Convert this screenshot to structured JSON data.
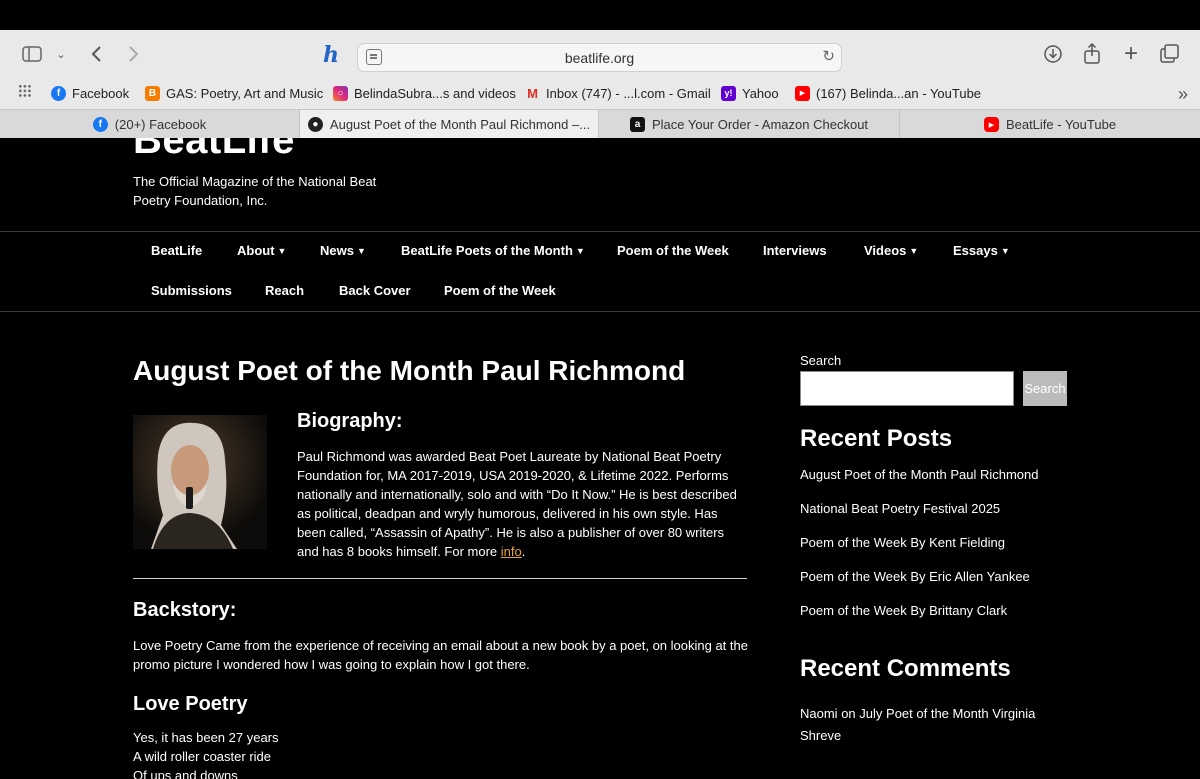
{
  "browser": {
    "url": "beatlife.org",
    "bookmarks": [
      {
        "label": "Facebook",
        "icon": "facebook-icon",
        "color": "#1877f2"
      },
      {
        "label": "GAS: Poetry, Art and Music",
        "icon": "blogger-icon",
        "color": "#f57c00"
      },
      {
        "label": "BelindaSubra...s and videos",
        "icon": "instagram-icon",
        "color": "#d6249f"
      },
      {
        "label": "Inbox (747) - ...l.com - Gmail",
        "icon": "gmail-icon",
        "color": "#d93025"
      },
      {
        "label": "Yahoo",
        "icon": "yahoo-icon",
        "color": "#6001d2"
      },
      {
        "label": "(167) Belinda...an - YouTube",
        "icon": "youtube-icon",
        "color": "#ff0000"
      }
    ],
    "tabs": [
      {
        "label": "(20+) Facebook",
        "icon": "facebook-icon",
        "color": "#1877f2"
      },
      {
        "label": "August Poet of the Month Paul Richmond –...",
        "icon": "beatlife-icon",
        "color": "#222222"
      },
      {
        "label": "Place Your Order - Amazon Checkout",
        "icon": "amazon-icon",
        "color": "#111111"
      },
      {
        "label": "BeatLife - YouTube",
        "icon": "youtube-icon",
        "color": "#ff0000"
      }
    ]
  },
  "site": {
    "logo": "BeatLife",
    "tagline": "The Official Magazine of the National Beat Poetry Foundation, Inc.",
    "nav": [
      {
        "label": "BeatLife",
        "caret": false
      },
      {
        "label": "About",
        "caret": true
      },
      {
        "label": "News",
        "caret": true
      },
      {
        "label": "BeatLife Poets of the Month",
        "caret": true
      },
      {
        "label": "Poem of the Week",
        "caret": false
      },
      {
        "label": "Interviews",
        "caret": false
      },
      {
        "label": "Videos",
        "caret": true
      },
      {
        "label": "Essays",
        "caret": true
      },
      {
        "label": "Submissions",
        "caret": false
      },
      {
        "label": "Reach",
        "caret": false
      },
      {
        "label": "Back Cover",
        "caret": false
      },
      {
        "label": "Poem of the Week",
        "caret": false
      }
    ]
  },
  "post": {
    "title": "August Poet of the Month Paul Richmond",
    "bio_heading": "Biography:",
    "bio_text": "Paul Richmond was awarded Beat Poet Laureate by National Beat Poetry Foundation for, MA 2017-2019, USA 2019-2020, & Lifetime 2022. Performs nationally and internationally, solo and with “Do It Now.” He is best described as political, deadpan and wryly humorous, delivered in his own style. Has been called, “Assassin of Apathy”. He is also a publisher of over 80 writers and has 8 books himself. For more ",
    "bio_link": "info",
    "backstory_heading": "Backstory:",
    "backstory_text": "Love Poetry Came from the experience of receiving an email about a new book by a poet, on looking at the promo picture I wondered how I was going to explain how I got there.",
    "poem_title": "Love Poetry",
    "poem_lines": [
      "Yes, it has been 27 years",
      "A wild roller coaster ride",
      "Of ups and downs"
    ]
  },
  "sidebar": {
    "search_label": "Search",
    "search_button": "Search",
    "recent_posts_heading": "Recent Posts",
    "recent_posts": [
      "August Poet of the Month Paul Richmond",
      "National Beat Poetry Festival 2025",
      "Poem of the Week By Kent Fielding",
      "Poem of the Week By Eric Allen Yankee",
      "Poem of the Week By Brittany Clark"
    ],
    "recent_comments_heading": "Recent Comments",
    "comment_author": "Naomi",
    "comment_on": "on",
    "comment_post": "July Poet of the Month Virginia Shreve"
  },
  "colors": {
    "link_accent": "#e8a23a",
    "background": "#000000"
  }
}
